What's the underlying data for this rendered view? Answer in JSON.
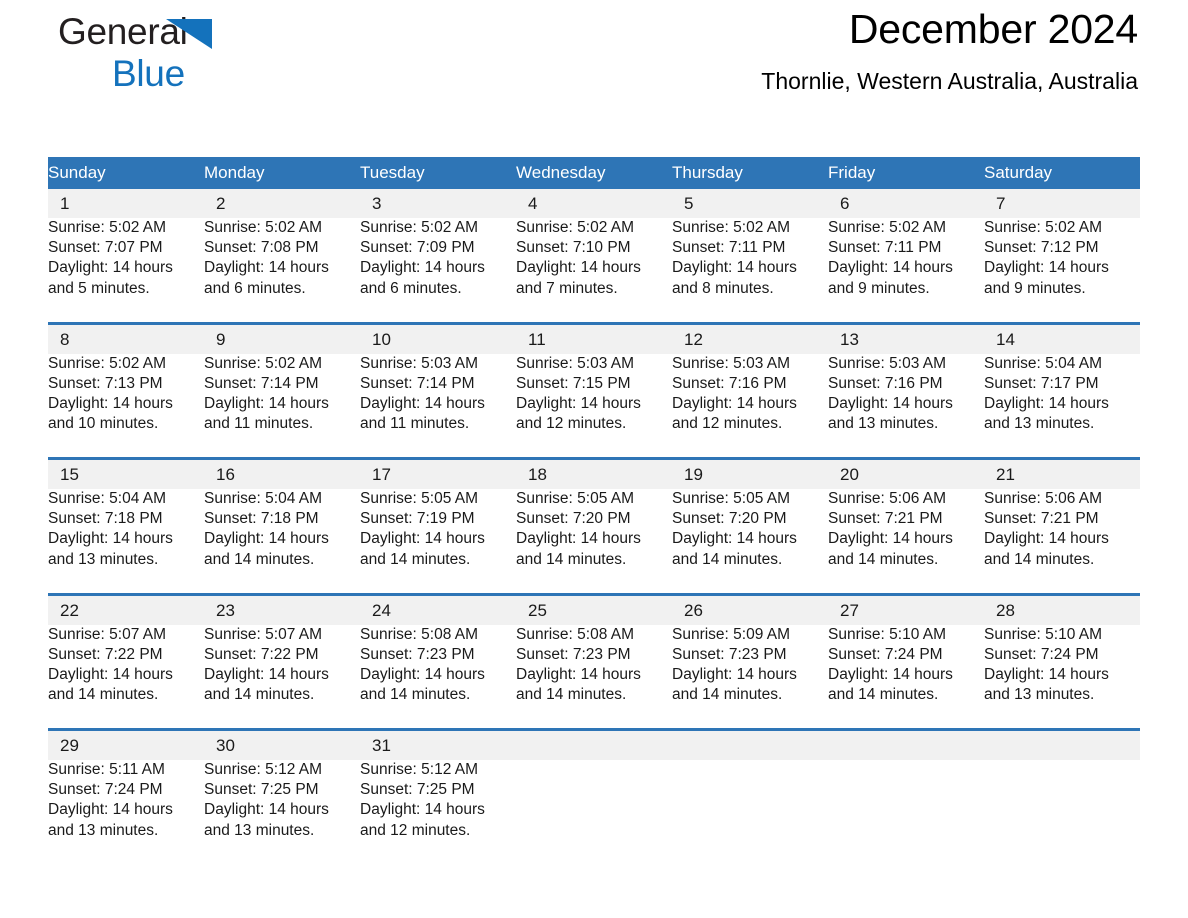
{
  "brand": {
    "name_part1": "General",
    "name_part2": "Blue",
    "triangle_color": "#1472bc",
    "text_color": "#231f20"
  },
  "header": {
    "title": "December 2024",
    "subtitle": "Thornlie, Western Australia, Australia"
  },
  "theme": {
    "header_blue": "#2e75b6",
    "day_band_gray": "#f1f1f1",
    "background": "#ffffff"
  },
  "calendar": {
    "day_names": [
      "Sunday",
      "Monday",
      "Tuesday",
      "Wednesday",
      "Thursday",
      "Friday",
      "Saturday"
    ],
    "weeks": [
      [
        {
          "day": "1",
          "sunrise": "Sunrise: 5:02 AM",
          "sunset": "Sunset: 7:07 PM",
          "daylight_line1": "Daylight: 14 hours",
          "daylight_line2": "and 5 minutes."
        },
        {
          "day": "2",
          "sunrise": "Sunrise: 5:02 AM",
          "sunset": "Sunset: 7:08 PM",
          "daylight_line1": "Daylight: 14 hours",
          "daylight_line2": "and 6 minutes."
        },
        {
          "day": "3",
          "sunrise": "Sunrise: 5:02 AM",
          "sunset": "Sunset: 7:09 PM",
          "daylight_line1": "Daylight: 14 hours",
          "daylight_line2": "and 6 minutes."
        },
        {
          "day": "4",
          "sunrise": "Sunrise: 5:02 AM",
          "sunset": "Sunset: 7:10 PM",
          "daylight_line1": "Daylight: 14 hours",
          "daylight_line2": "and 7 minutes."
        },
        {
          "day": "5",
          "sunrise": "Sunrise: 5:02 AM",
          "sunset": "Sunset: 7:11 PM",
          "daylight_line1": "Daylight: 14 hours",
          "daylight_line2": "and 8 minutes."
        },
        {
          "day": "6",
          "sunrise": "Sunrise: 5:02 AM",
          "sunset": "Sunset: 7:11 PM",
          "daylight_line1": "Daylight: 14 hours",
          "daylight_line2": "and 9 minutes."
        },
        {
          "day": "7",
          "sunrise": "Sunrise: 5:02 AM",
          "sunset": "Sunset: 7:12 PM",
          "daylight_line1": "Daylight: 14 hours",
          "daylight_line2": "and 9 minutes."
        }
      ],
      [
        {
          "day": "8",
          "sunrise": "Sunrise: 5:02 AM",
          "sunset": "Sunset: 7:13 PM",
          "daylight_line1": "Daylight: 14 hours",
          "daylight_line2": "and 10 minutes."
        },
        {
          "day": "9",
          "sunrise": "Sunrise: 5:02 AM",
          "sunset": "Sunset: 7:14 PM",
          "daylight_line1": "Daylight: 14 hours",
          "daylight_line2": "and 11 minutes."
        },
        {
          "day": "10",
          "sunrise": "Sunrise: 5:03 AM",
          "sunset": "Sunset: 7:14 PM",
          "daylight_line1": "Daylight: 14 hours",
          "daylight_line2": "and 11 minutes."
        },
        {
          "day": "11",
          "sunrise": "Sunrise: 5:03 AM",
          "sunset": "Sunset: 7:15 PM",
          "daylight_line1": "Daylight: 14 hours",
          "daylight_line2": "and 12 minutes."
        },
        {
          "day": "12",
          "sunrise": "Sunrise: 5:03 AM",
          "sunset": "Sunset: 7:16 PM",
          "daylight_line1": "Daylight: 14 hours",
          "daylight_line2": "and 12 minutes."
        },
        {
          "day": "13",
          "sunrise": "Sunrise: 5:03 AM",
          "sunset": "Sunset: 7:16 PM",
          "daylight_line1": "Daylight: 14 hours",
          "daylight_line2": "and 13 minutes."
        },
        {
          "day": "14",
          "sunrise": "Sunrise: 5:04 AM",
          "sunset": "Sunset: 7:17 PM",
          "daylight_line1": "Daylight: 14 hours",
          "daylight_line2": "and 13 minutes."
        }
      ],
      [
        {
          "day": "15",
          "sunrise": "Sunrise: 5:04 AM",
          "sunset": "Sunset: 7:18 PM",
          "daylight_line1": "Daylight: 14 hours",
          "daylight_line2": "and 13 minutes."
        },
        {
          "day": "16",
          "sunrise": "Sunrise: 5:04 AM",
          "sunset": "Sunset: 7:18 PM",
          "daylight_line1": "Daylight: 14 hours",
          "daylight_line2": "and 14 minutes."
        },
        {
          "day": "17",
          "sunrise": "Sunrise: 5:05 AM",
          "sunset": "Sunset: 7:19 PM",
          "daylight_line1": "Daylight: 14 hours",
          "daylight_line2": "and 14 minutes."
        },
        {
          "day": "18",
          "sunrise": "Sunrise: 5:05 AM",
          "sunset": "Sunset: 7:20 PM",
          "daylight_line1": "Daylight: 14 hours",
          "daylight_line2": "and 14 minutes."
        },
        {
          "day": "19",
          "sunrise": "Sunrise: 5:05 AM",
          "sunset": "Sunset: 7:20 PM",
          "daylight_line1": "Daylight: 14 hours",
          "daylight_line2": "and 14 minutes."
        },
        {
          "day": "20",
          "sunrise": "Sunrise: 5:06 AM",
          "sunset": "Sunset: 7:21 PM",
          "daylight_line1": "Daylight: 14 hours",
          "daylight_line2": "and 14 minutes."
        },
        {
          "day": "21",
          "sunrise": "Sunrise: 5:06 AM",
          "sunset": "Sunset: 7:21 PM",
          "daylight_line1": "Daylight: 14 hours",
          "daylight_line2": "and 14 minutes."
        }
      ],
      [
        {
          "day": "22",
          "sunrise": "Sunrise: 5:07 AM",
          "sunset": "Sunset: 7:22 PM",
          "daylight_line1": "Daylight: 14 hours",
          "daylight_line2": "and 14 minutes."
        },
        {
          "day": "23",
          "sunrise": "Sunrise: 5:07 AM",
          "sunset": "Sunset: 7:22 PM",
          "daylight_line1": "Daylight: 14 hours",
          "daylight_line2": "and 14 minutes."
        },
        {
          "day": "24",
          "sunrise": "Sunrise: 5:08 AM",
          "sunset": "Sunset: 7:23 PM",
          "daylight_line1": "Daylight: 14 hours",
          "daylight_line2": "and 14 minutes."
        },
        {
          "day": "25",
          "sunrise": "Sunrise: 5:08 AM",
          "sunset": "Sunset: 7:23 PM",
          "daylight_line1": "Daylight: 14 hours",
          "daylight_line2": "and 14 minutes."
        },
        {
          "day": "26",
          "sunrise": "Sunrise: 5:09 AM",
          "sunset": "Sunset: 7:23 PM",
          "daylight_line1": "Daylight: 14 hours",
          "daylight_line2": "and 14 minutes."
        },
        {
          "day": "27",
          "sunrise": "Sunrise: 5:10 AM",
          "sunset": "Sunset: 7:24 PM",
          "daylight_line1": "Daylight: 14 hours",
          "daylight_line2": "and 14 minutes."
        },
        {
          "day": "28",
          "sunrise": "Sunrise: 5:10 AM",
          "sunset": "Sunset: 7:24 PM",
          "daylight_line1": "Daylight: 14 hours",
          "daylight_line2": "and 13 minutes."
        }
      ],
      [
        {
          "day": "29",
          "sunrise": "Sunrise: 5:11 AM",
          "sunset": "Sunset: 7:24 PM",
          "daylight_line1": "Daylight: 14 hours",
          "daylight_line2": "and 13 minutes."
        },
        {
          "day": "30",
          "sunrise": "Sunrise: 5:12 AM",
          "sunset": "Sunset: 7:25 PM",
          "daylight_line1": "Daylight: 14 hours",
          "daylight_line2": "and 13 minutes."
        },
        {
          "day": "31",
          "sunrise": "Sunrise: 5:12 AM",
          "sunset": "Sunset: 7:25 PM",
          "daylight_line1": "Daylight: 14 hours",
          "daylight_line2": "and 12 minutes."
        },
        {
          "day": "",
          "sunrise": "",
          "sunset": "",
          "daylight_line1": "",
          "daylight_line2": ""
        },
        {
          "day": "",
          "sunrise": "",
          "sunset": "",
          "daylight_line1": "",
          "daylight_line2": ""
        },
        {
          "day": "",
          "sunrise": "",
          "sunset": "",
          "daylight_line1": "",
          "daylight_line2": ""
        },
        {
          "day": "",
          "sunrise": "",
          "sunset": "",
          "daylight_line1": "",
          "daylight_line2": ""
        }
      ]
    ]
  }
}
